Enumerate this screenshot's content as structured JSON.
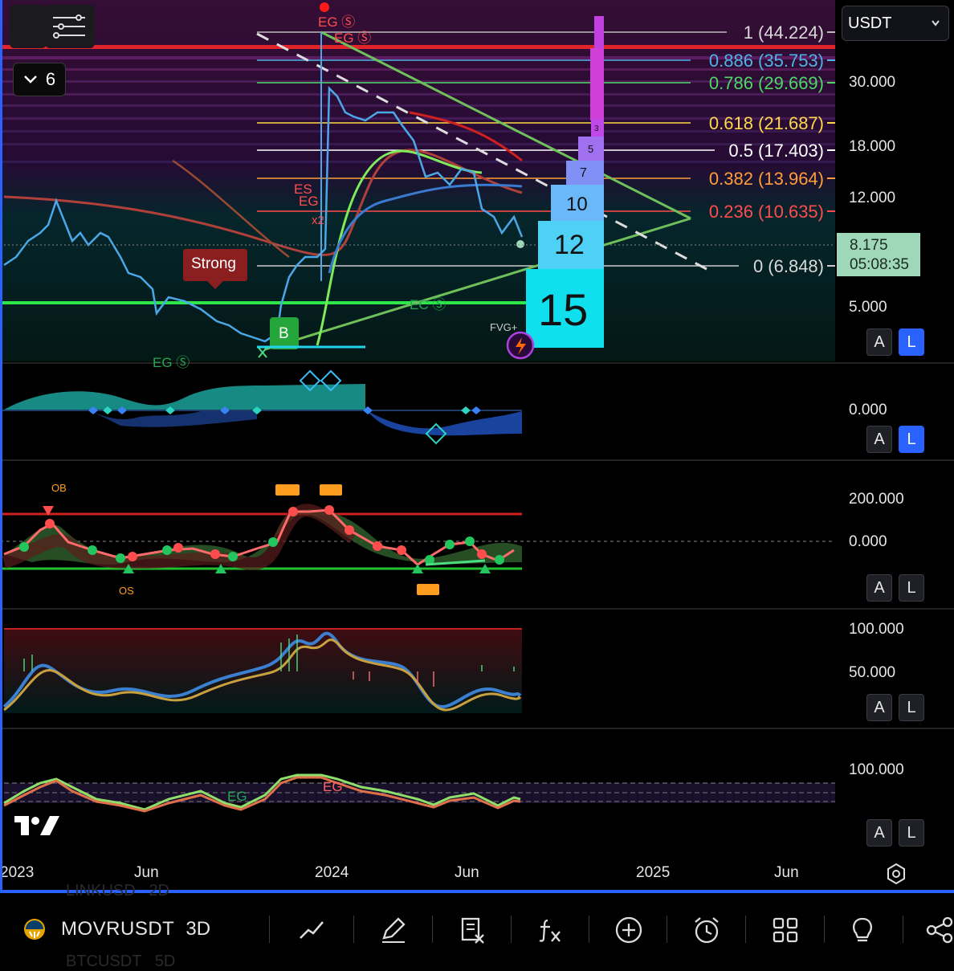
{
  "currency_select": {
    "value": "USDT"
  },
  "indicator_toggle": {
    "count": "6"
  },
  "price_axis": [
    "30.000",
    "18.000",
    "12.000",
    "5.000"
  ],
  "fib_levels": [
    {
      "label": "1 (44.224)",
      "color": "#d9d9d9"
    },
    {
      "label": "0.886 (35.753)",
      "color": "#4fb3e8"
    },
    {
      "label": "0.786 (29.669)",
      "color": "#4cd964"
    },
    {
      "label": "0.618 (21.687)",
      "color": "#ffd84a"
    },
    {
      "label": "0.5 (17.403)",
      "color": "#ffffff"
    },
    {
      "label": "0.382 (13.964)",
      "color": "#ff9d3a"
    },
    {
      "label": "0.236 (10.635)",
      "color": "#ff4d4d"
    },
    {
      "label": "0 (6.848)",
      "color": "#d9d9d9"
    }
  ],
  "current_price": {
    "value": "8.175",
    "countdown": "05:08:35"
  },
  "chart_labels": {
    "strong": "Strong",
    "buy": "B",
    "eg_top": "EG Ⓢ",
    "eg_top2": "EG Ⓢ",
    "es": "ES",
    "eg_mid": "EG",
    "x2": "x2",
    "eg_bottom": "EG Ⓢ",
    "ec": "EC Ⓢ",
    "fvg_plus": "FVG+",
    "pane5_eg": "EG",
    "pane5_eg2": "EG"
  },
  "volume_profile": [
    "15",
    "12",
    "10",
    "7",
    "5",
    "3"
  ],
  "pane2_axis": [
    "0.000"
  ],
  "pane3_axis": [
    "200.000",
    "0.000"
  ],
  "pane4_axis": [
    "100.000",
    "50.000"
  ],
  "pane5_axis": [
    "100.000"
  ],
  "pane3_markers": {
    "ob": "OB",
    "os": "OS"
  },
  "pane_buttons": {
    "a": "A",
    "l": "L"
  },
  "time_axis": [
    "2023",
    "Jun",
    "2024",
    "Jun",
    "2025",
    "Jun"
  ],
  "toolbar": {
    "symbol": "MOVRUSDT",
    "interval": "3D",
    "ghost_top": "LINKUSD   2D",
    "ghost_bottom": "BTCUSDT   5D"
  },
  "colors": {
    "accent": "#2962ff",
    "bull": "#22c55e",
    "bear": "#ef4444",
    "price_badge": "#9fd8b8"
  }
}
